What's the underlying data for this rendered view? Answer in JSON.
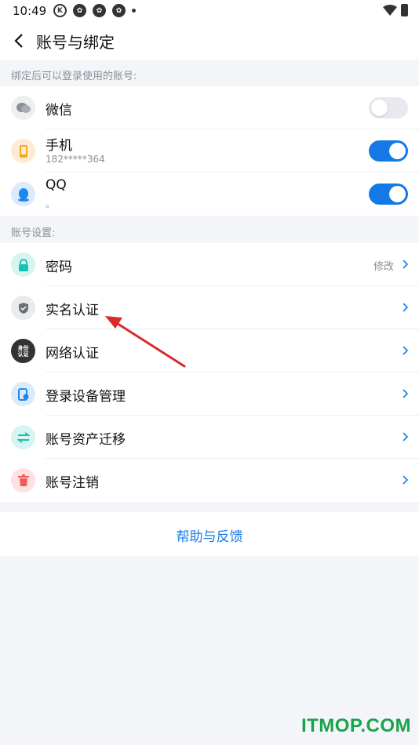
{
  "status": {
    "time": "10:49",
    "icon_k": "K"
  },
  "header": {
    "title": "账号与绑定"
  },
  "sections": {
    "binding_label": "绑定后可以登录使用的账号:",
    "settings_label": "账号设置:"
  },
  "bindings": [
    {
      "label": "微信",
      "sub": "",
      "enabled": false,
      "icon": "wechat-icon",
      "color": "#8b8f96"
    },
    {
      "label": "手机",
      "sub": "182*****364",
      "enabled": true,
      "icon": "phone-icon",
      "color": "#f5a623"
    },
    {
      "label": "QQ",
      "sub": "。",
      "enabled": true,
      "icon": "qq-icon",
      "color": "#1a88f0"
    }
  ],
  "settings": [
    {
      "label": "密码",
      "value": "修改",
      "icon": "lock-icon",
      "color": "#17c2b0"
    },
    {
      "label": "实名认证",
      "value": "",
      "icon": "shield-icon",
      "color": "#6b6f76"
    },
    {
      "label": "网络认证",
      "value": "",
      "icon": "network-id-icon",
      "color": "#333333",
      "badge": "身份认证"
    },
    {
      "label": "登录设备管理",
      "value": "",
      "icon": "device-icon",
      "color": "#1a88f0"
    },
    {
      "label": "账号资产迁移",
      "value": "",
      "icon": "transfer-icon",
      "color": "#17c2b0"
    },
    {
      "label": "账号注销",
      "value": "",
      "icon": "trash-icon",
      "color": "#f05a5a"
    }
  ],
  "help": {
    "label": "帮助与反馈"
  },
  "watermark": "ITMOP.COM",
  "colors": {
    "accent": "#1478e6",
    "toggle_off": "#e7e9ee",
    "annotation": "#d82a2a",
    "watermark": "#1aa34a"
  }
}
